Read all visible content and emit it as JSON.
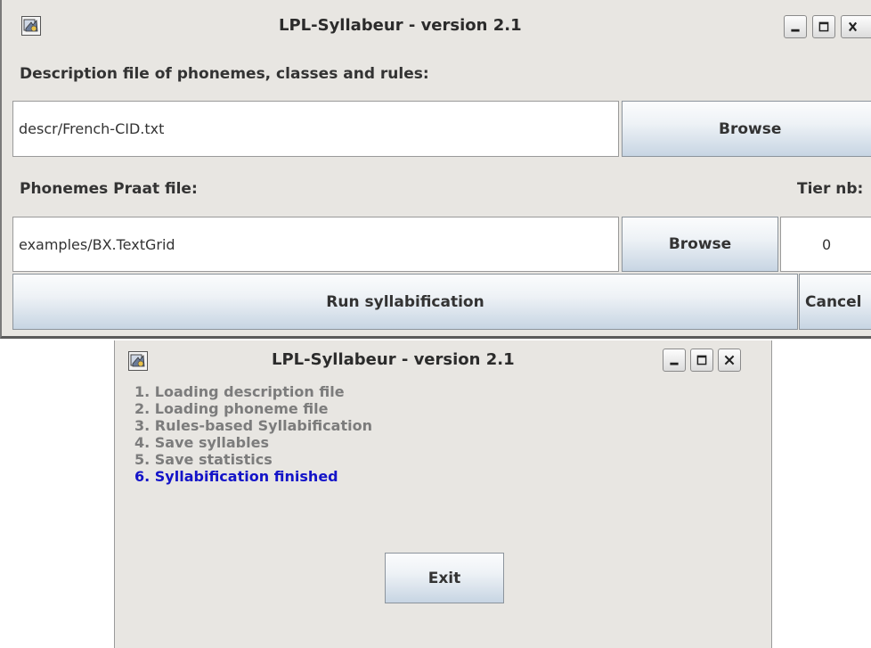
{
  "main_window": {
    "title": "LPL-Syllabeur - version 2.1",
    "description_label": "Description file of phonemes, classes and rules:",
    "description_value": "descr/French-CID.txt",
    "browse_description_label": "Browse",
    "phonemes_label": "Phonemes Praat file:",
    "tier_label": "Tier nb:",
    "phonemes_value": "examples/BX.TextGrid",
    "browse_phonemes_label": "Browse",
    "tier_value": "0",
    "run_label": "Run syllabification",
    "cancel_label": "Cancel"
  },
  "progress_window": {
    "title": "LPL-Syllabeur - version 2.1",
    "steps": [
      "1. Loading description file",
      "2. Loading phoneme file",
      "3. Rules-based Syllabification",
      "4. Save syllables",
      "5. Save statistics",
      "6. Syllabification finished"
    ],
    "exit_label": "Exit"
  },
  "colors": {
    "window_bg": "#e8e6e2",
    "step_pending": "#7c7c7c",
    "step_finished": "#1414c8"
  },
  "icons": {
    "app": "app-icon",
    "minimize": "minimize-icon",
    "maximize": "maximize-icon",
    "close": "close-icon"
  }
}
